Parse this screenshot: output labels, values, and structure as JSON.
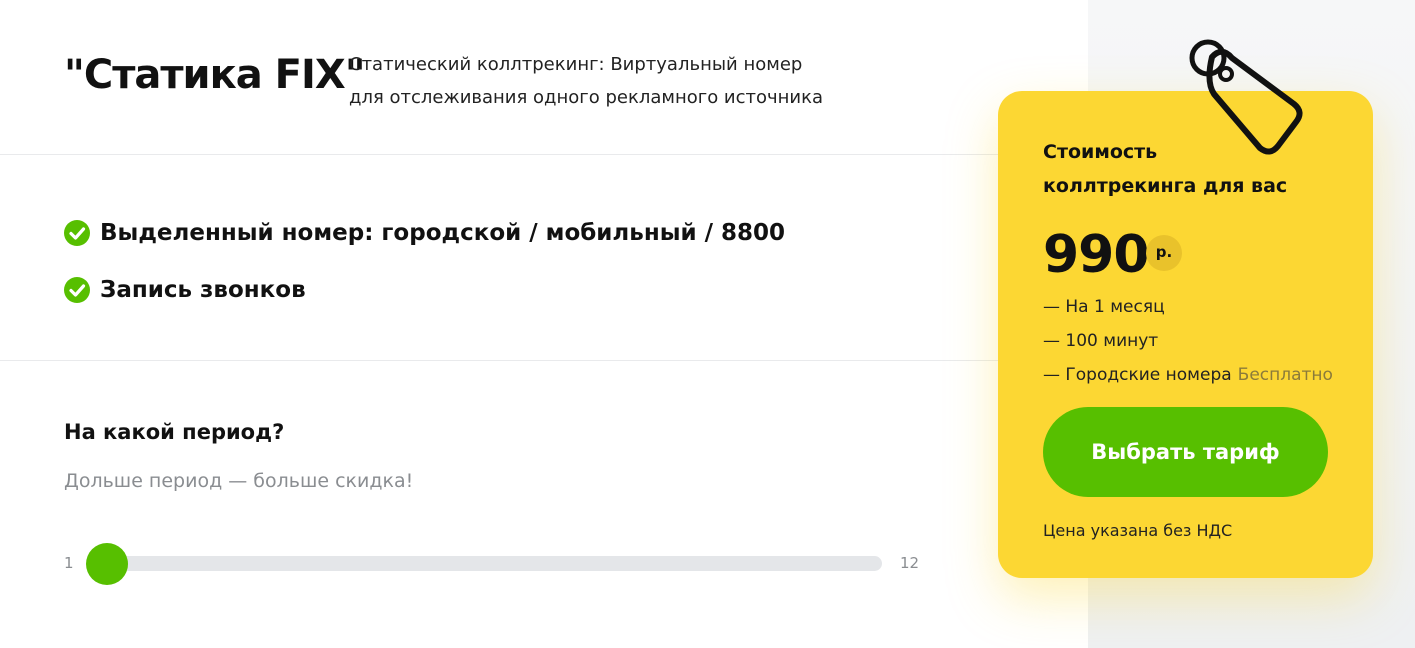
{
  "plan": {
    "title": "\"Статика FIX\"",
    "description_line1": "Статический коллтрекинг: Виртуальный номер",
    "description_line2": "для отслеживания одного рекламного источника"
  },
  "features": [
    {
      "label": "Выделенный номер: городской / мобильный / 8800",
      "icon": "check-circle-icon"
    },
    {
      "label": "Запись звонков",
      "icon": "check-circle-icon"
    }
  ],
  "period": {
    "title": "На какой период?",
    "hint": "Дольше период — больше скидка!",
    "min_label": "1",
    "max_label": "12",
    "value": 1
  },
  "price_card": {
    "icon": "price-tag-icon",
    "title_line1": "Стоимость",
    "title_line2": "коллтрекинга для вас",
    "price": "990",
    "currency": "р.",
    "details": [
      {
        "text": "— На 1 месяц",
        "badge": ""
      },
      {
        "text": "— 100 минут",
        "badge": ""
      },
      {
        "text": "— Городские номера",
        "badge": "Бесплатно"
      }
    ],
    "button_label": "Выбрать тариф",
    "vat_note": "Цена указана без НДС"
  },
  "colors": {
    "accent_green": "#57bf00",
    "card_yellow": "#fcd733",
    "muted_text": "#8a8d91"
  }
}
